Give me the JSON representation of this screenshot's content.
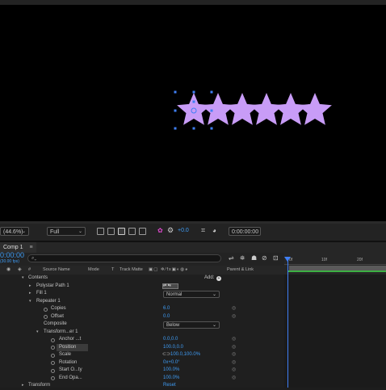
{
  "viewer": {
    "shape_color": "#c89cf7",
    "handle_color": "#3f7ff5",
    "zoom": "(44.6%)",
    "resolution": "Full",
    "exposure": "+0.0",
    "timecode": "0:00:00:00"
  },
  "comp": {
    "tab_label": "Comp 1",
    "timecode": "0:00:00",
    "fps": "(30.00 fps)",
    "search_placeholder": "⌕⌄",
    "columns": {
      "hash": "#",
      "source_name": "Source Name",
      "mode": "Mode",
      "t": "T",
      "track_matte": "Track Matte",
      "parent": "Parent & Link"
    }
  },
  "layers": {
    "contents": "Contents",
    "add_label": "Add:",
    "polystar_path": "Polystar Path 1",
    "fill": "Fill 1",
    "fill_mode": "Normal",
    "repeater": "Repeater 1",
    "copies_label": "Copies",
    "copies_value": "6.0",
    "offset_label": "Offset",
    "offset_value": "0.0",
    "composite_label": "Composite",
    "composite_value": "Below",
    "transform_group": "Transform...er 1",
    "anchor_label": "Anchor ...t",
    "anchor_value": "0.0,0.0",
    "position_label": "Position",
    "position_value": "100.0,0.0",
    "scale_label": "Scale",
    "scale_value": "100.0,100.0%",
    "rotation_label": "Rotation",
    "rotation_value": "0x+0.0°",
    "start_opacity_label": "Start O...ty",
    "start_opacity_value": "100.0%",
    "end_opacity_label": "End Opa...",
    "end_opacity_value": "100.0%",
    "transform": "Transform",
    "reset": "Reset"
  },
  "timeline": {
    "marks": [
      "0f",
      "10f",
      "20f"
    ]
  }
}
